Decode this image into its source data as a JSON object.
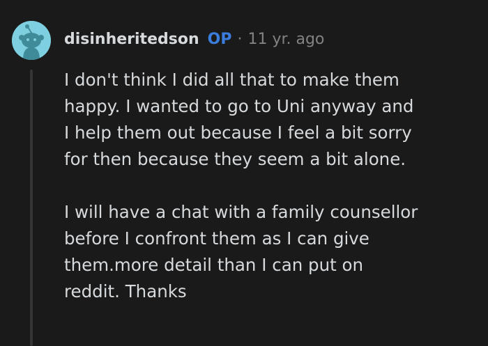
{
  "comment": {
    "author": "disinheritedson",
    "op_badge": "OP",
    "separator": "·",
    "timestamp": "11 yr. ago",
    "avatar_icon": "reddit-snoo-avatar-icon",
    "paragraphs": [
      "I don't think I did all that to make them\nhappy. I wanted to go to Uni anyway and\nI help them out because I feel a bit sorry\nfor then because they seem a bit alone.",
      "I will have a chat with a family counsellor\nbefore I confront them as I can give\nthem.more detail than I can put on\nreddit. Thanks"
    ]
  },
  "colors": {
    "background": "#1a1a1b",
    "text": "#d7dadc",
    "op_badge": "#3b7ddd",
    "muted": "#818384",
    "avatar_bg": "#7ecfe0",
    "thread_line": "#343536"
  }
}
